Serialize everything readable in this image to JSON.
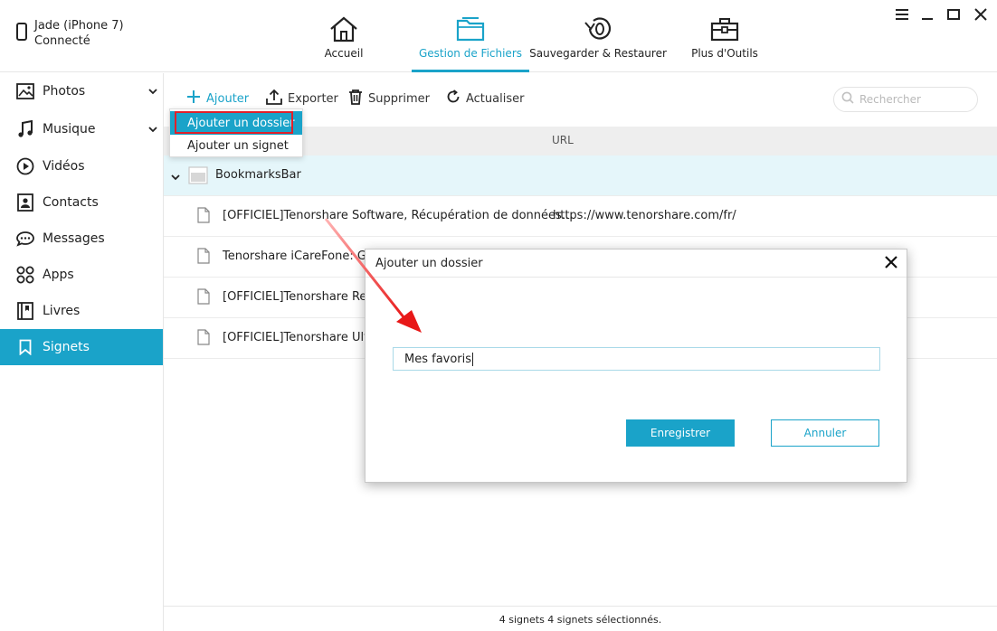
{
  "device": {
    "name": "Jade (iPhone 7)",
    "status": "Connecté"
  },
  "nav": {
    "tabs": [
      {
        "label": "Accueil",
        "icon": "home-icon"
      },
      {
        "label": "Gestion de Fichiers",
        "icon": "folder-icon",
        "active": true
      },
      {
        "label": "Sauvegarder & Restaurer",
        "icon": "backup-restore-icon"
      },
      {
        "label": "Plus d'Outils",
        "icon": "toolbox-icon"
      }
    ]
  },
  "sidebar": {
    "items": [
      {
        "label": "Photos",
        "icon": "photo-icon",
        "expandable": true
      },
      {
        "label": "Musique",
        "icon": "music-icon",
        "expandable": true
      },
      {
        "label": "Vidéos",
        "icon": "play-icon"
      },
      {
        "label": "Contacts",
        "icon": "contact-icon"
      },
      {
        "label": "Messages",
        "icon": "message-icon"
      },
      {
        "label": "Apps",
        "icon": "apps-icon"
      },
      {
        "label": "Livres",
        "icon": "book-icon"
      },
      {
        "label": "Signets",
        "icon": "bookmark-icon",
        "active": true
      }
    ]
  },
  "toolbar": {
    "add_label": "Ajouter",
    "export_label": "Exporter",
    "delete_label": "Supprimer",
    "refresh_label": "Actualiser",
    "search_placeholder": "Rechercher"
  },
  "dropdown": {
    "items": [
      {
        "label": "Ajouter un dossier",
        "highlighted": true
      },
      {
        "label": "Ajouter un signet"
      }
    ]
  },
  "table": {
    "columns": {
      "url": "URL"
    },
    "folder": {
      "name": "BookmarksBar"
    },
    "rows": [
      {
        "title": "[OFFICIEL]Tenorshare Software, Récupération de données...",
        "url": "https://www.tenorshare.com/fr/"
      },
      {
        "title": "Tenorshare iCareFone: Gu",
        "url": ""
      },
      {
        "title": "[OFFICIEL]Tenorshare ReiBo",
        "url": ""
      },
      {
        "title": "[OFFICIEL]Tenorshare UltDa",
        "url": ""
      }
    ]
  },
  "dialog": {
    "title": "Ajouter un dossier",
    "input_value": "Mes favoris",
    "save_label": "Enregistrer",
    "cancel_label": "Annuler"
  },
  "status": {
    "text": "4 signets 4 signets sélectionnés."
  },
  "colors": {
    "accent": "#1aa3c9",
    "highlight_row": "#e5f6fa",
    "annotation_red": "#e0202a"
  }
}
